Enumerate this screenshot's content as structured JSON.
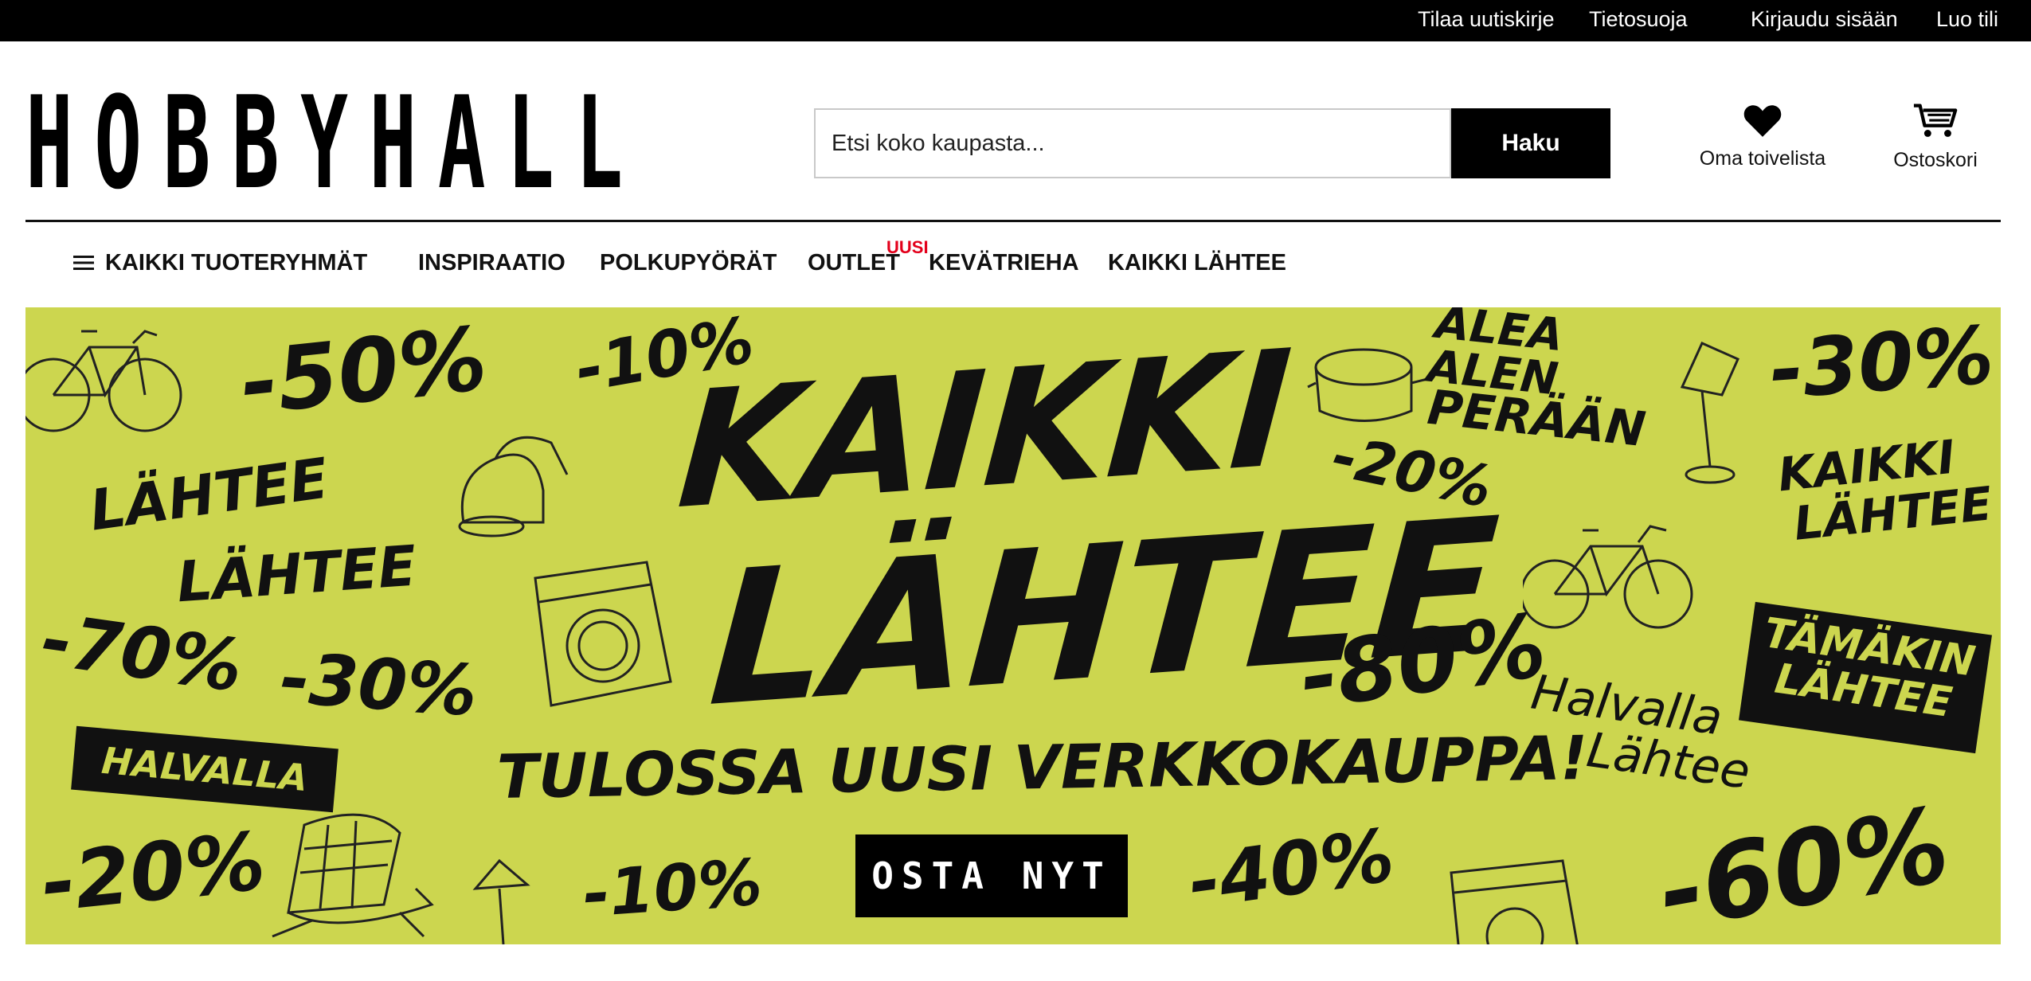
{
  "topbar": {
    "newsletter": "Tilaa uutiskirje",
    "privacy": "Tietosuoja",
    "login": "Kirjaudu sisään",
    "register": "Luo tili"
  },
  "logo": [
    "H",
    "O",
    "B",
    "B",
    "Y",
    "H",
    "A",
    "L",
    "L"
  ],
  "search": {
    "placeholder": "Etsi koko kaupasta...",
    "button": "Haku"
  },
  "header": {
    "wishlist": "Oma toivelista",
    "cart": "Ostoskori"
  },
  "nav": {
    "all_categories": "KAIKKI TUOTERYHMÄT",
    "inspiration": "INSPIRAATIO",
    "bicycles": "POLKUPYÖRÄT",
    "outlet": "OUTLET",
    "outlet_badge": "UUSI",
    "spring": "KEVÄTRIEHA",
    "clearance": "KAIKKI LÄHTEE"
  },
  "banner": {
    "headline_1": "KAIKKI",
    "headline_2": "LÄHTEE",
    "subline": "TULOSSA UUSI VERKKOKAUPPA!",
    "cta": "OSTA NYT",
    "bg_color": "#ccd64f",
    "labels": {
      "p50": "-50%",
      "p10a": "-10%",
      "p30a": "-30%",
      "p20a": "-20%",
      "p70": "-70%",
      "p30b": "-30%",
      "p80": "-80%",
      "p20b": "-20%",
      "p10b": "-10%",
      "p40": "-40%",
      "p60": "-60%",
      "alea_1": "ALEA",
      "alea_2": "ALEN",
      "alea_3": "PERÄÄN",
      "kl_1": "KAIKKI",
      "kl_2": "LÄHTEE",
      "ll_1": "LÄHTEE",
      "ll_2": "LÄHTEE",
      "halvalla": "HALVALLA",
      "tamakin_1": "TÄMÄKIN",
      "tamakin_2": "LÄHTEE",
      "hl_1": "Halvalla",
      "hl_2": "Lähtee"
    }
  }
}
